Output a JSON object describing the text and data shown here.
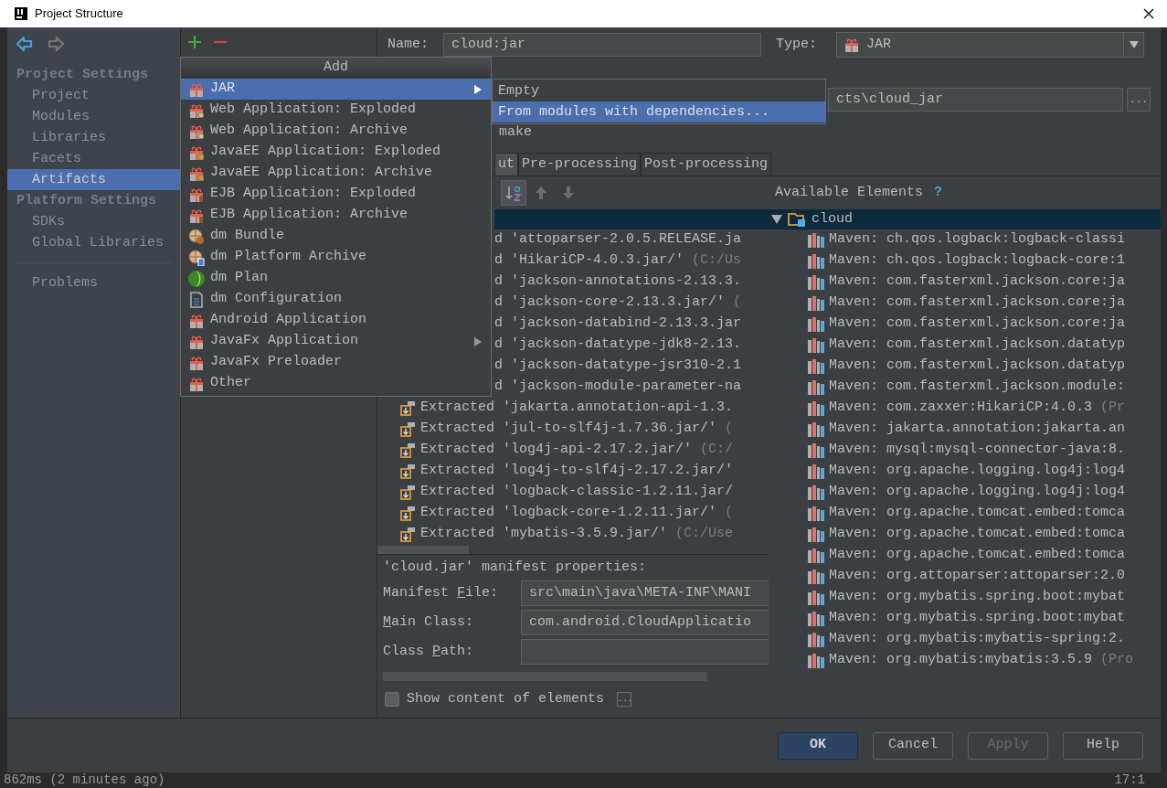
{
  "window": {
    "title": "Project Structure"
  },
  "sidebar": {
    "sections": [
      {
        "title": "Project Settings",
        "items": [
          {
            "label": "Project",
            "selected": false
          },
          {
            "label": "Modules",
            "selected": false
          },
          {
            "label": "Libraries",
            "selected": false
          },
          {
            "label": "Facets",
            "selected": false
          },
          {
            "label": "Artifacts",
            "selected": true
          }
        ]
      },
      {
        "title": "Platform Settings",
        "items": [
          {
            "label": "SDKs",
            "selected": false
          },
          {
            "label": "Global Libraries",
            "selected": false
          }
        ]
      }
    ],
    "problems": "Problems"
  },
  "artifact": {
    "name_label": "Name:",
    "name_value": "cloud:jar",
    "type_label": "Type:",
    "type_value": "JAR",
    "output_path": "cts\\cloud_jar",
    "browse": "...",
    "build_on_make": "make",
    "tabs": [
      {
        "label": "ut",
        "selected": true
      },
      {
        "label": "Pre-processing",
        "selected": false
      },
      {
        "label": "Post-processing",
        "selected": false
      }
    ],
    "available_title": "Available Elements",
    "help": "?",
    "layout_rows": [
      {
        "text": "d 'attoparser-2.0.5.RELEASE.ja",
        "covered": true
      },
      {
        "text": "d 'HikariCP-4.0.3.jar/'",
        "path": "(C:/Us",
        "covered": true
      },
      {
        "text": "d 'jackson-annotations-2.13.3.",
        "covered": true
      },
      {
        "text": "d 'jackson-core-2.13.3.jar/'",
        "path": "(",
        "covered": true
      },
      {
        "text": "d 'jackson-databind-2.13.3.jar",
        "covered": true
      },
      {
        "text": "d 'jackson-datatype-jdk8-2.13.",
        "covered": true
      },
      {
        "text": "d 'jackson-datatype-jsr310-2.1",
        "covered": true
      },
      {
        "text": "d 'jackson-module-parameter-na",
        "covered": true
      },
      {
        "text": "Extracted 'jakarta.annotation-api-1.3.",
        "covered": false
      },
      {
        "text": "Extracted 'jul-to-slf4j-1.7.36.jar/'",
        "path": "(",
        "covered": false
      },
      {
        "text": "Extracted 'log4j-api-2.17.2.jar/'",
        "path": "(C:/",
        "covered": false
      },
      {
        "text": "Extracted 'log4j-to-slf4j-2.17.2.jar/'",
        "covered": false
      },
      {
        "text": "Extracted 'logback-classic-1.2.11.jar/",
        "covered": false
      },
      {
        "text": "Extracted 'logback-core-1.2.11.jar/'",
        "path": "(",
        "covered": false
      },
      {
        "text": "Extracted 'mybatis-3.5.9.jar/'",
        "path": "(C:/Use",
        "covered": false
      }
    ],
    "available_root": {
      "label": "cloud",
      "expanded": true,
      "selected": true
    },
    "available_rows": [
      {
        "text": "Maven: ch.qos.logback:logback-classi"
      },
      {
        "text": "Maven: ch.qos.logback:logback-core:1"
      },
      {
        "text": "Maven: com.fasterxml.jackson.core:ja"
      },
      {
        "text": "Maven: com.fasterxml.jackson.core:ja"
      },
      {
        "text": "Maven: com.fasterxml.jackson.core:ja"
      },
      {
        "text": "Maven: com.fasterxml.jackson.datatyp"
      },
      {
        "text": "Maven: com.fasterxml.jackson.datatyp"
      },
      {
        "text": "Maven: com.fasterxml.jackson.module:"
      },
      {
        "text": "Maven: com.zaxxer:HikariCP:4.0.3",
        "path": "(Pr"
      },
      {
        "text": "Maven: jakarta.annotation:jakarta.an"
      },
      {
        "text": "Maven: mysql:mysql-connector-java:8."
      },
      {
        "text": "Maven: org.apache.logging.log4j:log4"
      },
      {
        "text": "Maven: org.apache.logging.log4j:log4"
      },
      {
        "text": "Maven: org.apache.tomcat.embed:tomca"
      },
      {
        "text": "Maven: org.apache.tomcat.embed:tomca"
      },
      {
        "text": "Maven: org.apache.tomcat.embed:tomca"
      },
      {
        "text": "Maven: org.attoparser:attoparser:2.0"
      },
      {
        "text": "Maven: org.mybatis.spring.boot:mybat"
      },
      {
        "text": "Maven: org.mybatis.spring.boot:mybat"
      },
      {
        "text": "Maven: org.mybatis:mybatis-spring:2."
      },
      {
        "text": "Maven: org.mybatis:mybatis:3.5.9",
        "path": "(Pro"
      }
    ],
    "manifest": {
      "title": "'cloud.jar' manifest properties:",
      "fields": [
        {
          "label_parts": {
            "before": "Manifest ",
            "key": "F",
            "after": "ile:"
          },
          "value": "src\\main\\java\\META-INF\\MANI"
        },
        {
          "label_parts": {
            "key": "M",
            "after": "ain Class:"
          },
          "value": "com.android.CloudApplicatio"
        },
        {
          "label_parts": {
            "before": "Class ",
            "key": "P",
            "after": "ath:"
          }
        }
      ]
    },
    "show_content": {
      "label": "Show content of elements",
      "checked": false,
      "more": "..."
    }
  },
  "add_menu": {
    "title": "Add",
    "items": [
      {
        "label": "JAR",
        "kind": "gift",
        "selected": true,
        "submenu": true
      },
      {
        "label": "Web Application: Exploded",
        "kind": "web",
        "selected": false,
        "submenu": false
      },
      {
        "label": "Web Application: Archive",
        "kind": "web",
        "selected": false,
        "submenu": false
      },
      {
        "label": "JavaEE Application: Exploded",
        "kind": "javaee",
        "selected": false,
        "submenu": false
      },
      {
        "label": "JavaEE Application: Archive",
        "kind": "javaee",
        "selected": false,
        "submenu": false
      },
      {
        "label": "EJB Application: Exploded",
        "kind": "ejb",
        "selected": false,
        "submenu": false
      },
      {
        "label": "EJB Application: Archive",
        "kind": "ejb",
        "selected": false,
        "submenu": false
      },
      {
        "label": "dm Bundle",
        "kind": "bundle",
        "selected": false,
        "submenu": false
      },
      {
        "label": "dm Platform Archive",
        "kind": "archive",
        "selected": false,
        "submenu": false
      },
      {
        "label": "dm Plan",
        "kind": "plan",
        "selected": false,
        "submenu": false
      },
      {
        "label": "dm Configuration",
        "kind": "config",
        "selected": false,
        "submenu": false
      },
      {
        "label": "Android Application",
        "kind": "gift",
        "selected": false,
        "submenu": false
      },
      {
        "label": "JavaFx Application",
        "kind": "gift",
        "selected": false,
        "submenu": true
      },
      {
        "label": "JavaFx Preloader",
        "kind": "gift",
        "selected": false,
        "submenu": false
      },
      {
        "label": "Other",
        "kind": "gift",
        "selected": false,
        "submenu": false
      }
    ]
  },
  "submenu": {
    "items": [
      {
        "label": "Empty",
        "selected": false
      },
      {
        "label": "From modules with dependencies...",
        "selected": true
      }
    ]
  },
  "buttons": [
    {
      "label": "OK",
      "kind": "default",
      "disabled": false
    },
    {
      "label": "Cancel",
      "kind": "normal",
      "disabled": false
    },
    {
      "label": "Apply",
      "kind": "normal",
      "disabled": true
    },
    {
      "label": "Help",
      "kind": "normal",
      "disabled": false
    }
  ],
  "status_bar": {
    "left": "862ms (2 minutes ago)",
    "right": "17:1"
  }
}
